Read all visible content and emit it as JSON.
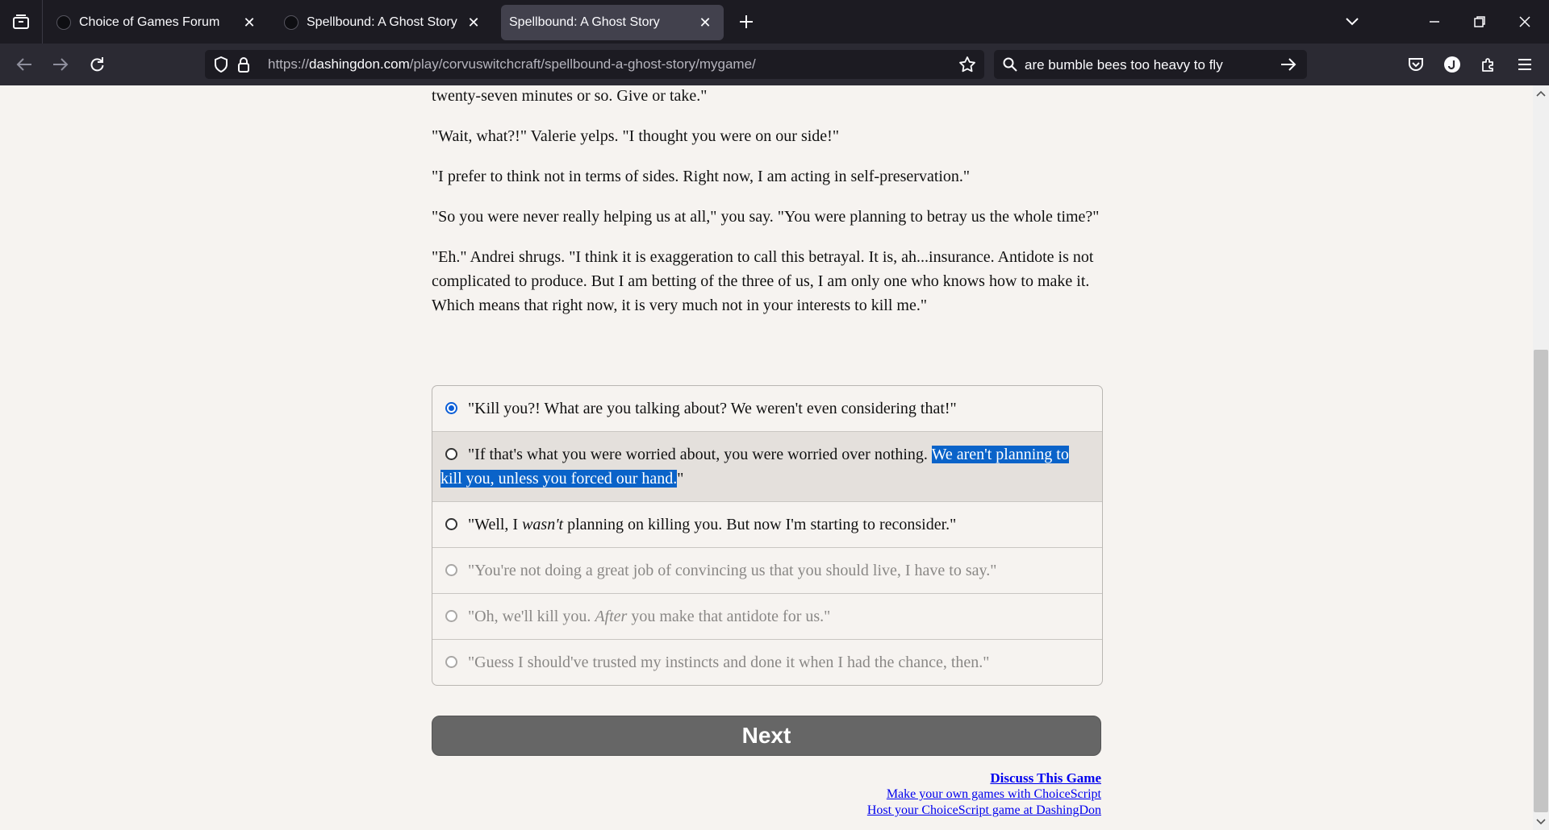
{
  "browser": {
    "tabs": [
      {
        "title": "Choice of Games Forum",
        "active": false
      },
      {
        "title": "Spellbound: A Ghost Story (WIP",
        "active": false
      },
      {
        "title": "Spellbound: A Ghost Story",
        "active": true
      }
    ],
    "url": {
      "prefix": "https://",
      "host": "dashingdon.com",
      "path": "/play/corvuswitchcraft/spellbound-a-ghost-story/mygame/"
    },
    "search_text": "are bumble bees too heavy to fly"
  },
  "story": {
    "paragraphs": [
      "twenty-seven minutes or so. Give or take.\"",
      "\"Wait, what?!\" Valerie yelps. \"I thought you were on our side!\"",
      "\"I prefer to think not in terms of sides. Right now, I am acting in self-preservation.\"",
      "\"So you were never really helping us at all,\" you say. \"You were planning to betray us the whole time?\"",
      "\"Eh.\" Andrei shrugs. \"I think it is exaggeration to call this betrayal. It is, ah...insurance. Antidote is not complicated to produce. But I am betting of the three of us, I am only one who knows how to make it. Which means that right now, it is very much not in your interests to kill me.\""
    ]
  },
  "choices": {
    "c1": {
      "text": "\"Kill you?! What are you talking about? We weren't even considering that!\""
    },
    "c2": {
      "before": "\"If that's what you were worried about, you were worried over nothing. ",
      "selected": "We aren't planning to kill you, unless you forced our hand.",
      "after": "\""
    },
    "c3": {
      "before": "\"Well, I ",
      "em": "wasn't",
      "after": " planning on killing you. But now I'm starting to reconsider.\""
    },
    "c4": {
      "text": "\"You're not doing a great job of convincing us that you should live, I have to say.\""
    },
    "c5": {
      "before": "\"Oh, we'll kill you. ",
      "em": "After",
      "after": " you make that antidote for us.\""
    },
    "c6": {
      "text": "\"Guess I should've trusted my instincts and done it when I had the chance, then.\""
    }
  },
  "next_label": "Next",
  "footer": {
    "discuss": "Discuss This Game",
    "make": "Make your own games with ChoiceScript",
    "host": "Host your ChoiceScript game at DashingDon"
  },
  "colors": {
    "page_bg": "#f6f3f0",
    "chrome_dark": "#1c1b22",
    "toolbar": "#2b2a33",
    "radio_accent": "#0b5ed7",
    "selection": "#0a63c9",
    "link": "#0000ee",
    "button": "#666666"
  }
}
